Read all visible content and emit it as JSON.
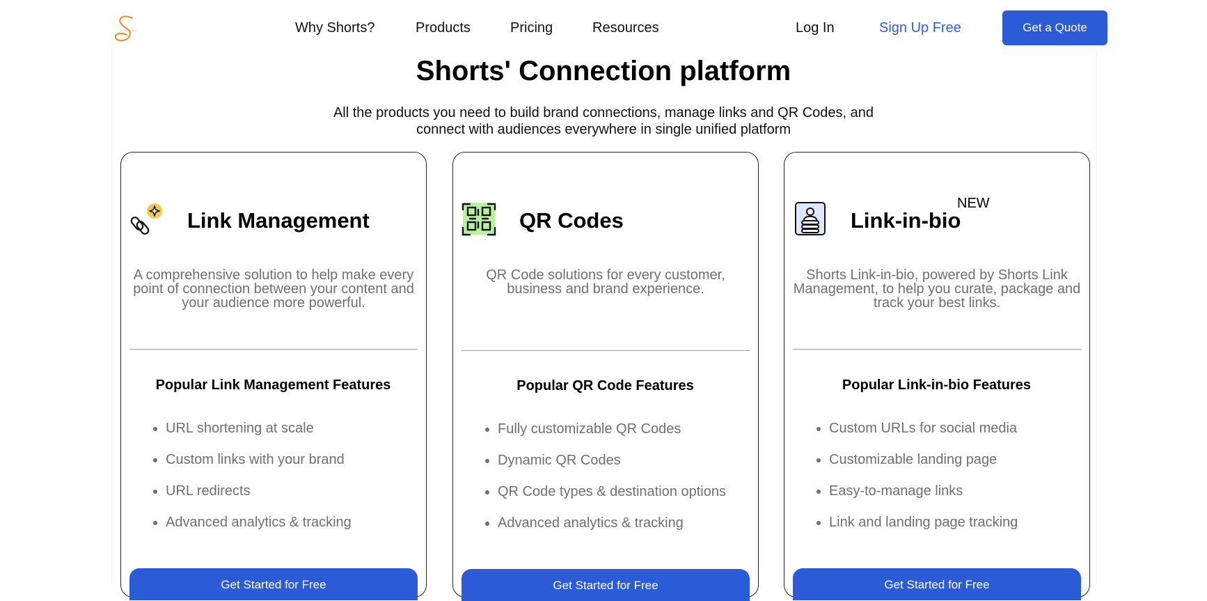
{
  "brand": {
    "name": "Shorts",
    "accent": "#2b5bd7",
    "logo_color": "#e8901e"
  },
  "header": {
    "nav": [
      "Why Shorts?",
      "Products",
      "Pricing",
      "Resources"
    ],
    "login": "Log In",
    "signup": "Sign Up Free",
    "quote": "Get a Quote"
  },
  "hero": {
    "title": "Shorts' Connection platform",
    "subtitle": "All the products you need to build brand connections, manage links and QR Codes, and connect with audiences everywhere in single unified platform"
  },
  "cards": [
    {
      "icon": "link-sparkle-icon",
      "title": "Link Management",
      "badge": "",
      "description": "A comprehensive solution to help make every point of connection between your content and your audience more powerful.",
      "features_heading": "Popular Link Management Features",
      "features": [
        "URL shortening at scale",
        "Custom links with your brand",
        "URL redirects",
        "Advanced analytics & tracking"
      ],
      "cta": "Get Started for Free"
    },
    {
      "icon": "qr-code-icon",
      "title": "QR Codes",
      "badge": "",
      "description": "QR Code solutions for every customer, business and brand experience.",
      "features_heading": "Popular QR Code Features",
      "features": [
        "Fully customizable QR Codes",
        "Dynamic QR Codes",
        "QR Code types & destination options",
        "Advanced analytics & tracking"
      ],
      "cta": "Get Started for Free"
    },
    {
      "icon": "profile-card-icon",
      "title": "Link-in-bio",
      "badge": "NEW",
      "description": "Shorts Link-in-bio, powered by Shorts Link Management, to help you curate, package and track your best links.",
      "features_heading": "Popular Link-in-bio Features",
      "features": [
        "Custom URLs for social media",
        "Customizable landing page",
        "Easy-to-manage links",
        "Link and landing page tracking"
      ],
      "cta": "Get Started for Free"
    }
  ]
}
